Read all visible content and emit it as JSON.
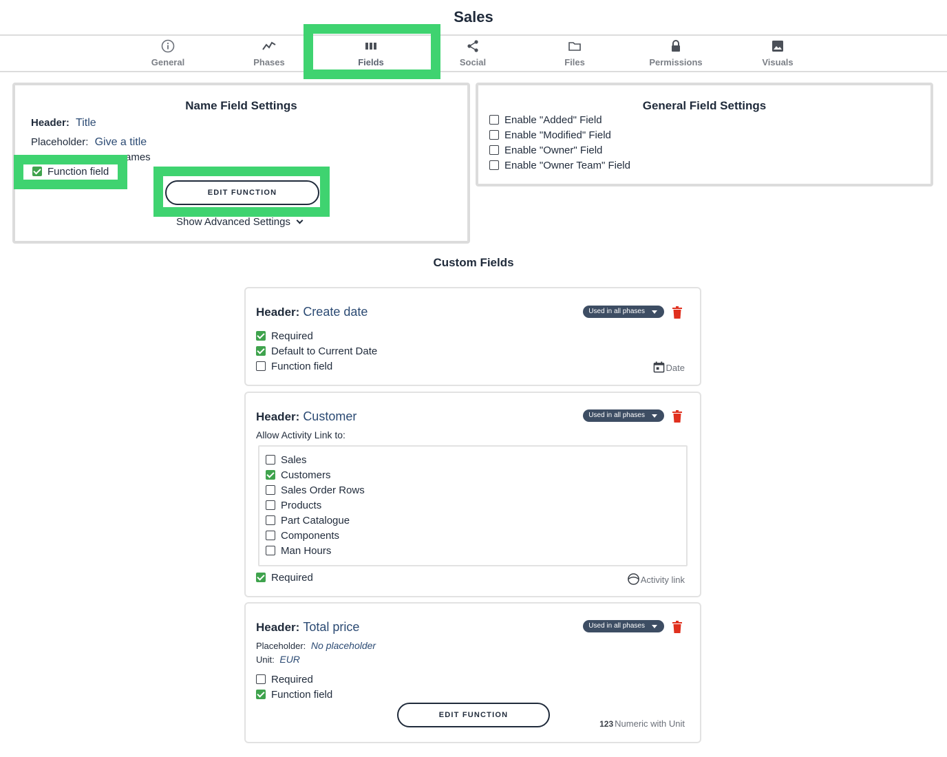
{
  "page": {
    "title": "Sales"
  },
  "tabs": [
    {
      "label": "General",
      "icon": "info-icon"
    },
    {
      "label": "Phases",
      "icon": "trend-icon"
    },
    {
      "label": "Fields",
      "icon": "columns-icon",
      "active": true
    },
    {
      "label": "Social",
      "icon": "share-icon"
    },
    {
      "label": "Files",
      "icon": "folder-icon"
    },
    {
      "label": "Permissions",
      "icon": "lock-icon"
    },
    {
      "label": "Visuals",
      "icon": "image-icon"
    }
  ],
  "name_settings": {
    "title": "Name Field Settings",
    "header_label": "Header:",
    "header_value": "Title",
    "placeholder_label": "Placeholder:",
    "placeholder_value": "Give a title",
    "hidden_row_tail": "ames",
    "function_field_label": "Function field",
    "function_field_checked": true,
    "edit_function_label": "EDIT FUNCTION",
    "show_advanced_label": "Show Advanced Settings"
  },
  "general_settings": {
    "title": "General Field Settings",
    "options": [
      {
        "label": "Enable \"Added\" Field",
        "checked": false
      },
      {
        "label": "Enable \"Modified\" Field",
        "checked": false
      },
      {
        "label": "Enable \"Owner\" Field",
        "checked": false
      },
      {
        "label": "Enable \"Owner Team\" Field",
        "checked": false
      }
    ]
  },
  "custom_fields": {
    "title": "Custom Fields",
    "cards": [
      {
        "header_label": "Header:",
        "header_value": "Create date",
        "phases_label": "Used in all phases",
        "options": [
          {
            "label": "Required",
            "checked": true
          },
          {
            "label": "Default to Current Date",
            "checked": true
          },
          {
            "label": "Function field",
            "checked": false
          }
        ],
        "type_label": "Date"
      },
      {
        "header_label": "Header:",
        "header_value": "Customer",
        "phases_label": "Used in all phases",
        "allow_link_label": "Allow Activity Link to:",
        "link_targets": [
          {
            "label": "Sales",
            "checked": false
          },
          {
            "label": "Customers",
            "checked": true
          },
          {
            "label": "Sales Order Rows",
            "checked": false
          },
          {
            "label": "Products",
            "checked": false
          },
          {
            "label": "Part Catalogue",
            "checked": false
          },
          {
            "label": "Components",
            "checked": false
          },
          {
            "label": "Man Hours",
            "checked": false
          }
        ],
        "required_label": "Required",
        "required_checked": true,
        "type_label": "Activity link"
      },
      {
        "header_label": "Header:",
        "header_value": "Total price",
        "phases_label": "Used in all phases",
        "placeholder_label": "Placeholder:",
        "placeholder_value": "No placeholder",
        "unit_label": "Unit:",
        "unit_value": "EUR",
        "options": [
          {
            "label": "Required",
            "checked": false
          },
          {
            "label": "Function field",
            "checked": true
          }
        ],
        "edit_function_label": "EDIT FUNCTION",
        "type_prefix": "123",
        "type_label": "Numeric with Unit"
      }
    ]
  },
  "colors": {
    "highlight": "#3fd370",
    "check_on": "#3fa34d",
    "accent_text": "#2b4a73",
    "pill": "#3d4d63",
    "trash": "#e0301e"
  }
}
